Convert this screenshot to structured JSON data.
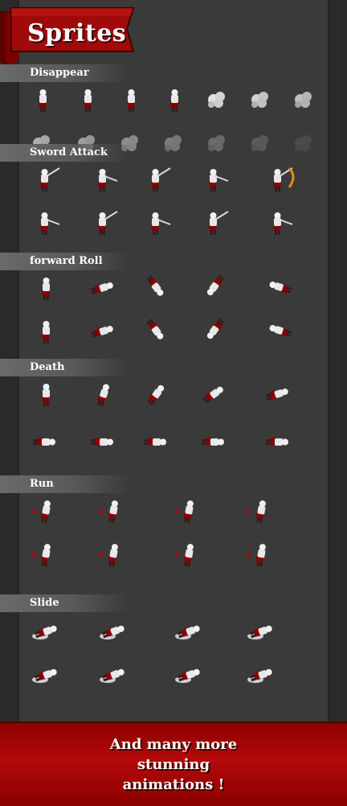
{
  "title": "Sprites",
  "sections": [
    {
      "label": "Disappear",
      "rows": [
        7,
        7
      ],
      "kind": "disappear"
    },
    {
      "label": "Sword Attack",
      "rows": [
        5,
        5
      ],
      "kind": "attack"
    },
    {
      "label": "forward Roll",
      "rows": [
        5,
        5
      ],
      "kind": "roll"
    },
    {
      "label": "Death",
      "rows": [
        5,
        5
      ],
      "kind": "death"
    },
    {
      "label": "Run",
      "rows": [
        4,
        4
      ],
      "kind": "run"
    },
    {
      "label": "Slide",
      "rows": [
        4,
        4
      ],
      "kind": "slide"
    }
  ],
  "footer": {
    "line1": "And many more",
    "line2": "stunning",
    "line3": "animations !"
  },
  "colors": {
    "accent_red": "#a00a0a",
    "panel": "#3a3a3a",
    "background": "#2f2f2f"
  }
}
